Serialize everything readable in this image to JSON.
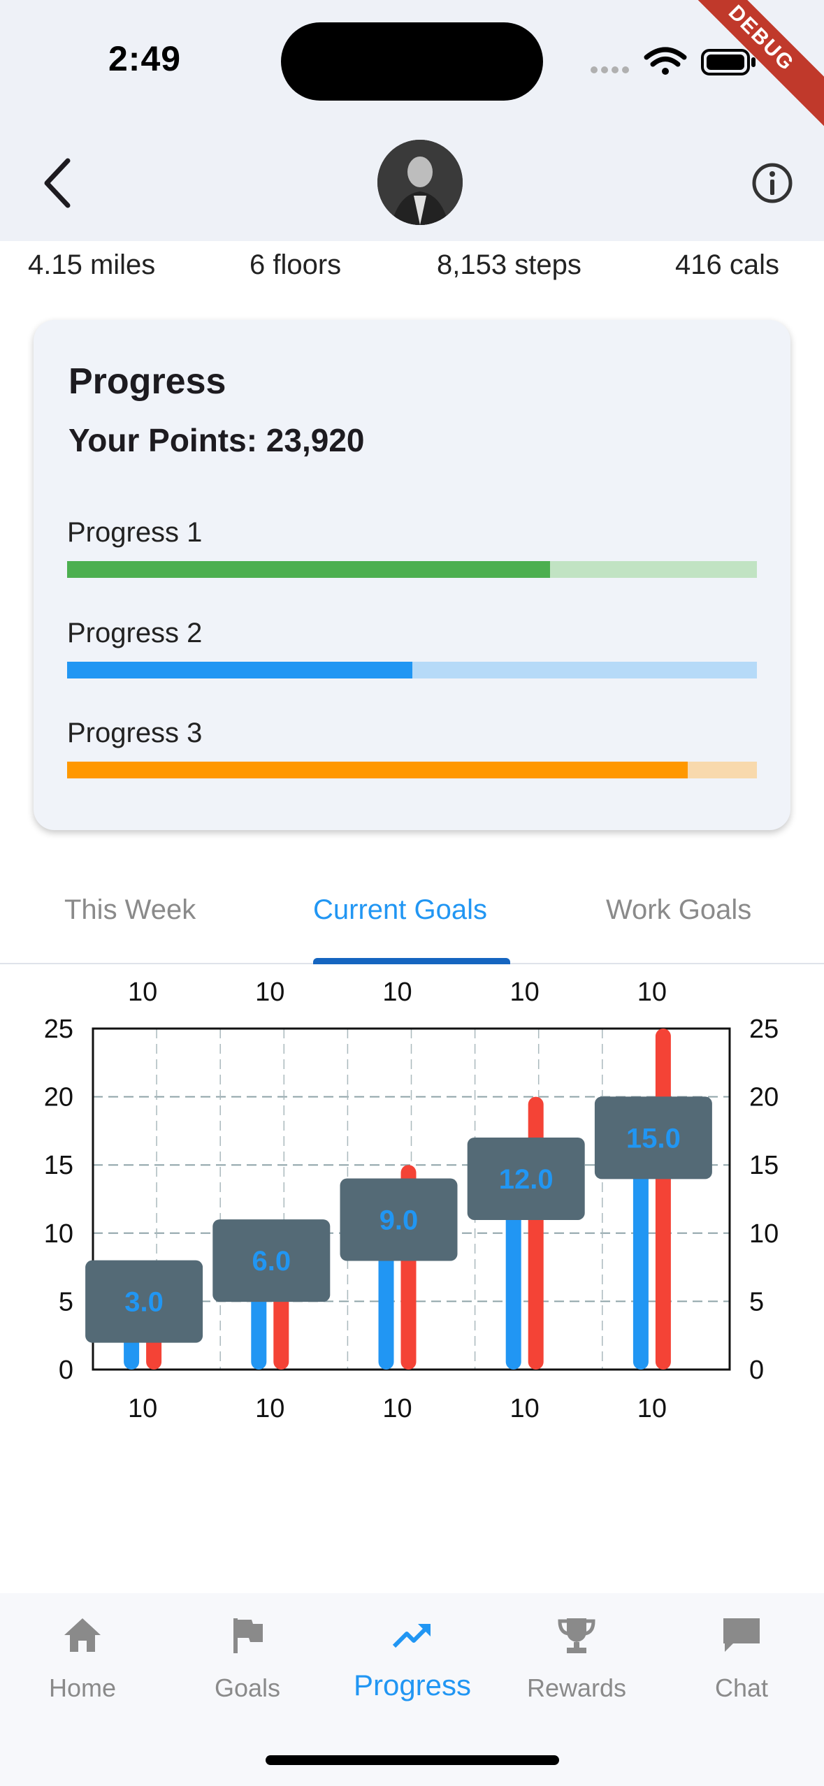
{
  "status_bar": {
    "time": "2:49",
    "debug_banner": "DEBUG"
  },
  "header": {
    "back_icon": "chevron-left-icon",
    "info_icon": "info-icon",
    "avatar": "user-avatar"
  },
  "stats": [
    "4.15 miles",
    "6 floors",
    "8,153 steps",
    "416 cals"
  ],
  "progress_card": {
    "title": "Progress",
    "points": "Your Points: 23,920",
    "bars": [
      {
        "label": "Progress 1",
        "value": 0.7,
        "color": "#4caf50",
        "track": "#c1e3c3"
      },
      {
        "label": "Progress 2",
        "value": 0.5,
        "color": "#2196f3",
        "track": "#b6daf8"
      },
      {
        "label": "Progress 3",
        "value": 0.9,
        "color": "#ff9800",
        "track": "#f8d9ad"
      }
    ]
  },
  "tabs": [
    {
      "label": "This Week",
      "active": false
    },
    {
      "label": "Current Goals",
      "active": true
    },
    {
      "label": "Work Goals",
      "active": false
    }
  ],
  "chart_data": {
    "type": "bar",
    "categories": [
      "10",
      "10",
      "10",
      "10",
      "10"
    ],
    "top_labels": [
      "10",
      "10",
      "10",
      "10",
      "10"
    ],
    "series": [
      {
        "values": [
          3,
          6,
          9,
          12,
          15
        ],
        "color": "#2196f3"
      },
      {
        "values": [
          5,
          10,
          15,
          20,
          25
        ],
        "color": "#f44336"
      }
    ],
    "tooltips": [
      "3.0",
      "6.0",
      "9.0",
      "12.0",
      "15.0"
    ],
    "ylim": [
      0,
      25
    ],
    "yticks": [
      "0",
      "5",
      "10",
      "15",
      "20",
      "25"
    ],
    "grid": true,
    "tooltip_color": "#546a76"
  },
  "bottom_nav": [
    {
      "label": "Home",
      "icon": "home-icon",
      "active": false
    },
    {
      "label": "Goals",
      "icon": "flag-icon",
      "active": false
    },
    {
      "label": "Progress",
      "icon": "trending-up-icon",
      "active": true
    },
    {
      "label": "Rewards",
      "icon": "trophy-icon",
      "active": false
    },
    {
      "label": "Chat",
      "icon": "chat-icon",
      "active": false
    }
  ]
}
